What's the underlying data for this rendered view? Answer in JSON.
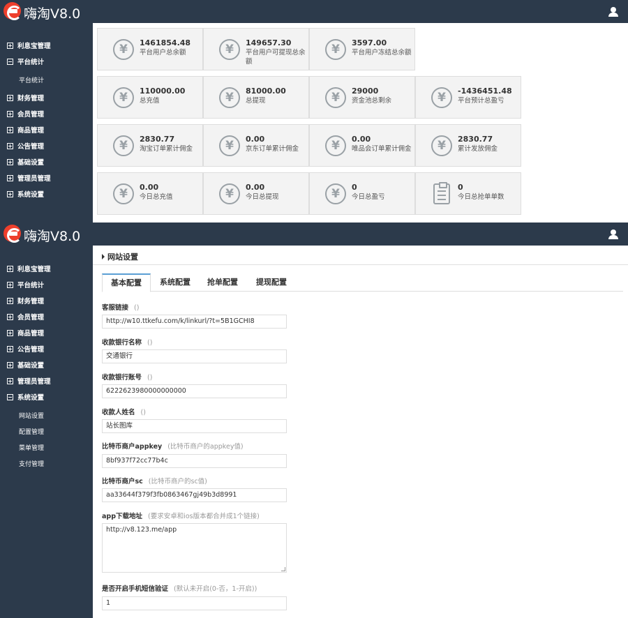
{
  "app": {
    "brand": "嗨淘V8.0"
  },
  "sidebar1": {
    "items": [
      {
        "label": "利息宝管理"
      },
      {
        "label": "平台统计"
      },
      {
        "label": "财务管理"
      },
      {
        "label": "会员管理"
      },
      {
        "label": "商品管理"
      },
      {
        "label": "公告管理"
      },
      {
        "label": "基础设置"
      },
      {
        "label": "管理员管理"
      },
      {
        "label": "系统设置"
      }
    ],
    "sub": [
      {
        "label": "平台统计"
      }
    ]
  },
  "stats": {
    "row1": [
      {
        "value": "1461854.48",
        "label": "平台用户总余额"
      },
      {
        "value": "149657.30",
        "label": "平台用户可提现总余额"
      },
      {
        "value": "3597.00",
        "label": "平台用户冻结总余额"
      }
    ],
    "row2": [
      {
        "value": "110000.00",
        "label": "总充值"
      },
      {
        "value": "81000.00",
        "label": "总提现"
      },
      {
        "value": "29000",
        "label": "资金池总剩余"
      },
      {
        "value": "-1436451.48",
        "label": "平台预计总盈亏"
      }
    ],
    "row3": [
      {
        "value": "2830.77",
        "label": "淘宝订单累计佣金"
      },
      {
        "value": "0.00",
        "label": "京东订单累计佣金"
      },
      {
        "value": "0.00",
        "label": "唯品会订单累计佣金"
      },
      {
        "value": "2830.77",
        "label": "累计发放佣金"
      }
    ],
    "row4": [
      {
        "value": "0.00",
        "label": "今日总充值"
      },
      {
        "value": "0.00",
        "label": "今日总提现"
      },
      {
        "value": "0",
        "label": "今日总盈亏"
      },
      {
        "value": "0",
        "label": "今日总抢单单数"
      }
    ],
    "currency_glyph": "¥"
  },
  "sidebar2": {
    "items": [
      {
        "label": "利息宝管理"
      },
      {
        "label": "平台统计"
      },
      {
        "label": "财务管理"
      },
      {
        "label": "会员管理"
      },
      {
        "label": "商品管理"
      },
      {
        "label": "公告管理"
      },
      {
        "label": "基础设置"
      },
      {
        "label": "管理员管理"
      },
      {
        "label": "系统设置"
      }
    ],
    "sub": [
      {
        "label": "网站设置"
      },
      {
        "label": "配置管理"
      },
      {
        "label": "菜单管理"
      },
      {
        "label": "支付管理"
      }
    ]
  },
  "settings": {
    "title": "网站设置",
    "tabs": [
      {
        "label": "基本配置"
      },
      {
        "label": "系统配置"
      },
      {
        "label": "抢单配置"
      },
      {
        "label": "提现配置"
      }
    ],
    "fields": [
      {
        "label": "客服链接",
        "hint": "()",
        "value": "http://w10.ttkefu.com/k/linkurl/?t=5B1GCHI8"
      },
      {
        "label": "收款银行名称",
        "hint": "()",
        "value": "交通银行"
      },
      {
        "label": "收款银行账号",
        "hint": "()",
        "value": "6222623980000000000"
      },
      {
        "label": "收款人姓名",
        "hint": "()",
        "value": "站长图库"
      },
      {
        "label": "比特币商户appkey",
        "hint": "(比特币商户的appkey值)",
        "value": "8bf937f72cc77b4c"
      },
      {
        "label": "比特币商户sc",
        "hint": "(比特币商户的sc值)",
        "value": "aa33644f379f3fb0863467gj49b3d8991"
      },
      {
        "label": "app下载地址",
        "hint": "(要求安卓和ios版本都合并成1个链接)",
        "value": "http://v8.123.me/app"
      },
      {
        "label": "是否开启手机短信验证",
        "hint": "(默认未开启(0-否，1-开启))",
        "value": "1"
      }
    ]
  },
  "colors": {
    "topbar": "#2c3a4b",
    "sidebar": "#2c3a4b",
    "logo": "#ee3f2c",
    "tile_bg": "#f3f3f3",
    "active_tab_border": "#5a9fd4"
  }
}
